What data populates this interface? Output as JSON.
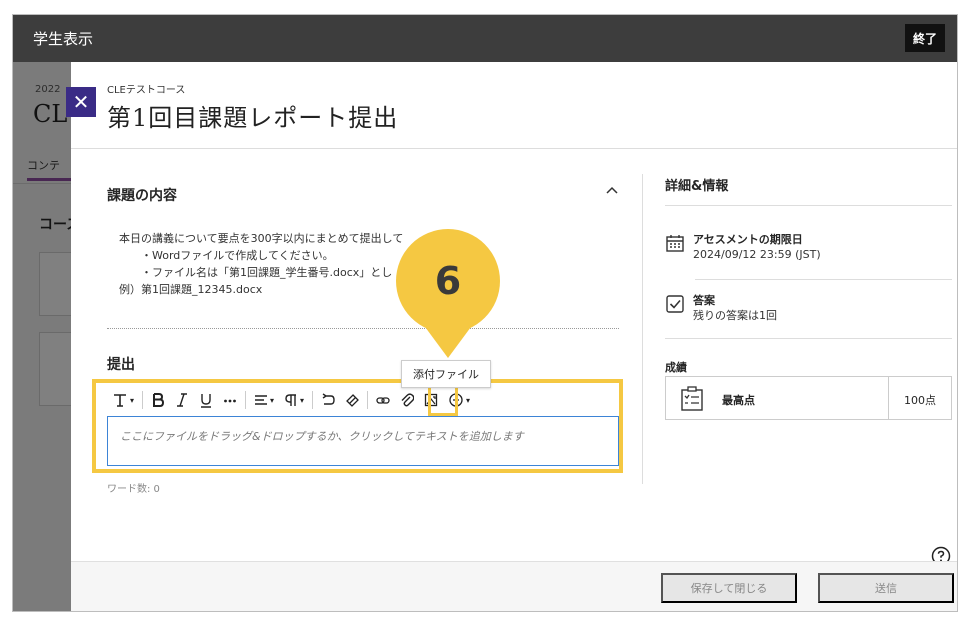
{
  "topbar": {
    "title": "学生表示",
    "end_label": "終了"
  },
  "background": {
    "year_text": "2022",
    "course_text": "CL",
    "tab_text": "コンテ",
    "section_text": "コース"
  },
  "panel": {
    "breadcrumb": "CLEテストコース",
    "title": "第1回目課題レポート提出",
    "task_section_title": "課題の内容",
    "description_lines": [
      "本日の講義について要点を300字以内にまとめて提出して",
      "　　・Wordファイルで作成してください。",
      "　　・ファイル名は「第1回課題_学生番号.docx」とし",
      "例）第1回課題_12345.docx"
    ],
    "submission_title": "提出",
    "editor_placeholder": "ここにファイルをドラッグ&ドロップするか、クリックしてテキストを追加します",
    "word_count": "ワード数: 0",
    "tooltip": "添付ファイル",
    "marker_number": "6"
  },
  "details": {
    "title": "詳細&情報",
    "due_label": "アセスメントの期限日",
    "due_value": "2024/09/12 23:59 (JST)",
    "attempts_label": "答案",
    "attempts_value": "残りの答案は1回",
    "grade_section": "成績",
    "grade_name": "最高点",
    "grade_points": "100点"
  },
  "footer": {
    "save_close": "保存して閉じる",
    "submit": "送信"
  },
  "colors": {
    "highlight": "#f5c842",
    "topbar": "#3d3d3d",
    "close_bg": "#3a2b86",
    "editor_border": "#3d84d6"
  }
}
